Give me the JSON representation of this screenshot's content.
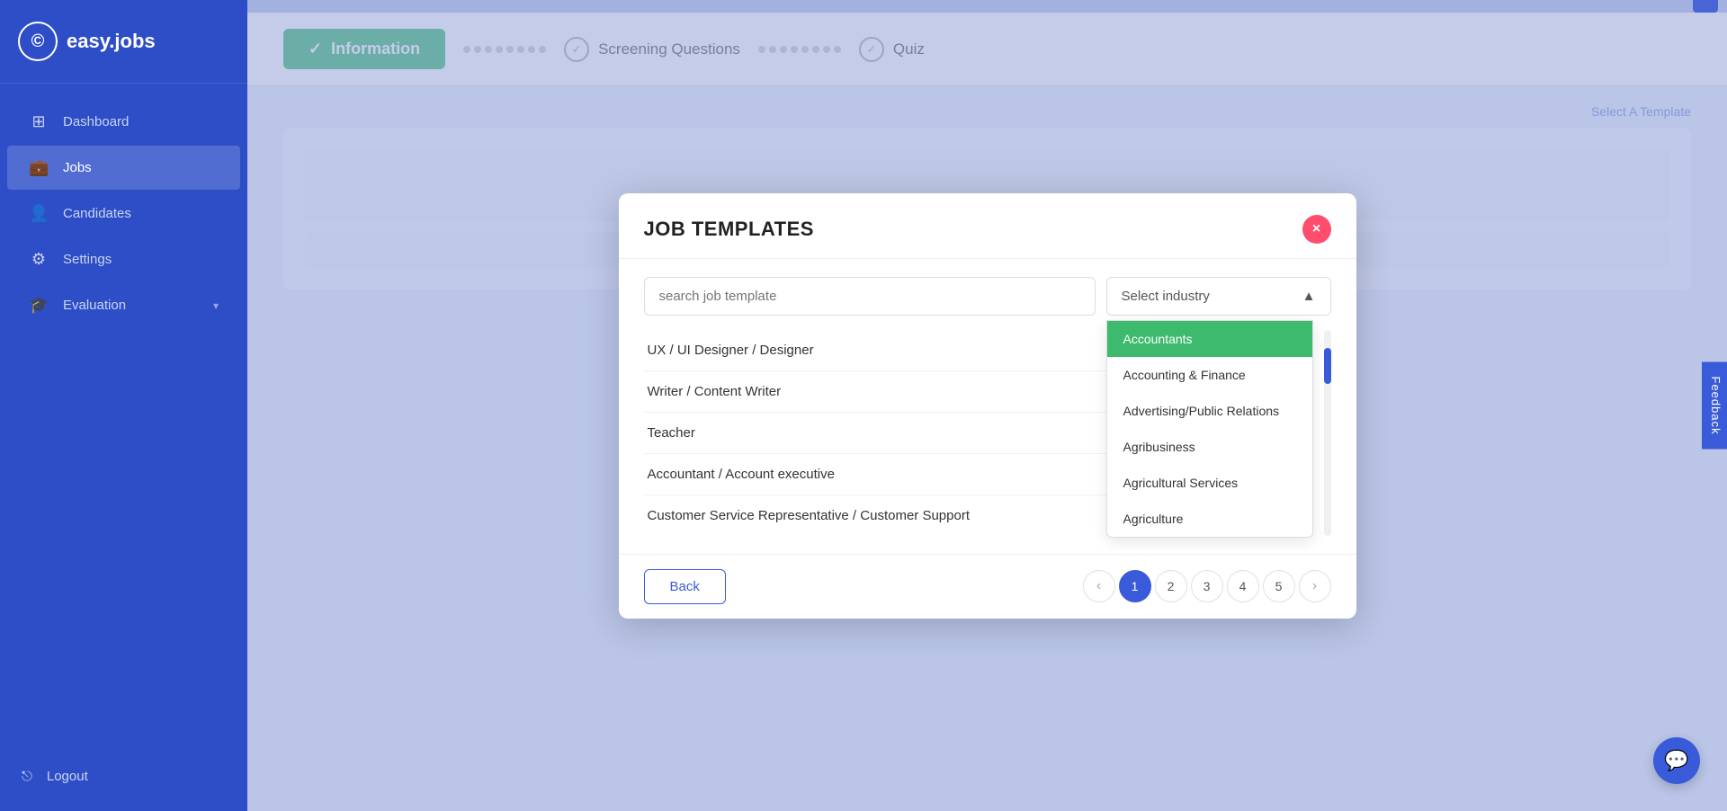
{
  "app": {
    "logo_icon": "©",
    "logo_text": "easy.jobs"
  },
  "sidebar": {
    "items": [
      {
        "id": "dashboard",
        "label": "Dashboard",
        "icon": "⊞"
      },
      {
        "id": "jobs",
        "label": "Jobs",
        "icon": "💼",
        "active": true
      },
      {
        "id": "candidates",
        "label": "Candidates",
        "icon": "👤"
      },
      {
        "id": "settings",
        "label": "Settings",
        "icon": "⚙"
      },
      {
        "id": "evaluation",
        "label": "Evaluation",
        "icon": "🎓"
      }
    ],
    "logout_label": "Logout",
    "logout_icon": "⎋"
  },
  "wizard": {
    "step1": {
      "label": "Information",
      "active": true
    },
    "step2": {
      "label": "Screening Questions"
    },
    "step3": {
      "label": "Quiz"
    }
  },
  "page": {
    "select_template_link": "Select A Template"
  },
  "modal": {
    "title": "JOB TEMPLATES",
    "close_label": "×",
    "search_placeholder": "search job template",
    "industry_placeholder": "Select industry",
    "job_items": [
      "UX / UI Designer / Designer",
      "Writer / Content Writer",
      "Teacher",
      "Accountant / Account executive",
      "Customer Service Representative / Customer Support"
    ],
    "industry_options": [
      {
        "label": "Accountants",
        "selected": true
      },
      {
        "label": "Accounting & Finance",
        "selected": false
      },
      {
        "label": "Advertising/Public Relations",
        "selected": false
      },
      {
        "label": "Agribusiness",
        "selected": false
      },
      {
        "label": "Agricultural Services",
        "selected": false
      },
      {
        "label": "Agriculture",
        "selected": false
      }
    ],
    "back_button": "Back",
    "pagination": {
      "current": 1,
      "pages": [
        "1",
        "2",
        "3",
        "4",
        "5"
      ]
    }
  },
  "feedback": {
    "label": "Feedback"
  }
}
